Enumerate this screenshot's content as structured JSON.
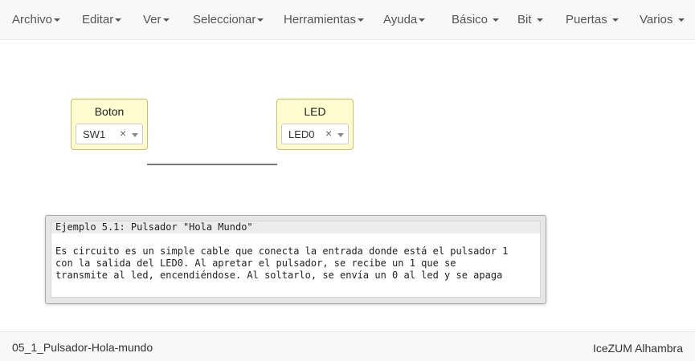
{
  "menubar": {
    "items": [
      {
        "label": "Archivo"
      },
      {
        "label": "Editar"
      },
      {
        "label": "Ver"
      },
      {
        "label": "Seleccionar"
      },
      {
        "label": "Herramientas"
      },
      {
        "label": "Ayuda"
      },
      {
        "label": "Básico"
      },
      {
        "label": "Bit"
      },
      {
        "label": "Puertas"
      },
      {
        "label": "Varios"
      }
    ]
  },
  "blocks": [
    {
      "title": "Boton",
      "selected": "SW1",
      "clear": "×"
    },
    {
      "title": "LED",
      "selected": "LED0",
      "clear": "×"
    }
  ],
  "comment": {
    "title": "Ejemplo 5.1: Pulsador \"Hola Mundo\"",
    "body": "Es circuito es un simple cable que conecta la entrada donde está el pulsador 1\ncon la salida del LED0. Al apretar el pulsador, se recibe un 1 que se\ntransmite al led, encendiéndose. Al soltarlo, se envía un 0 al led y se apaga"
  },
  "footer": {
    "project_name": "05_1_Pulsador-Hola-mundo",
    "board": "IceZUM Alhambra"
  },
  "colors": {
    "block_background": "#fffccf",
    "block_border": "#c6be6a",
    "wire": "#777777",
    "menubar_background": "#f8f8f8"
  }
}
